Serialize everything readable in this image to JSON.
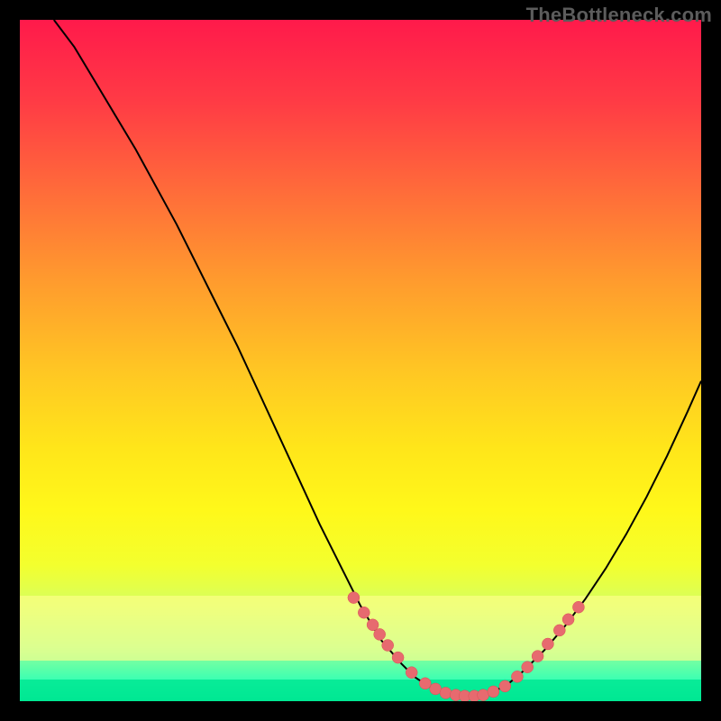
{
  "watermark": "TheBottleneck.com",
  "colors": {
    "gradient_top": "#ff1a4b",
    "gradient_bottom": "#00e893",
    "curve": "#000000",
    "marker": "#e76a6f",
    "frame_bg": "#000000"
  },
  "chart_data": {
    "type": "line",
    "title": "",
    "xlabel": "",
    "ylabel": "",
    "xlim": [
      0,
      100
    ],
    "ylim": [
      0,
      100
    ],
    "curve": {
      "x": [
        5,
        8,
        11,
        14,
        17,
        20,
        23,
        26,
        29,
        32,
        35,
        38,
        41,
        44,
        47,
        50,
        53,
        56,
        58,
        60,
        62,
        64,
        66,
        68,
        70,
        72,
        74,
        77,
        80,
        83,
        86,
        89,
        92,
        95,
        98,
        100
      ],
      "y": [
        100,
        96,
        91,
        86,
        81,
        75.5,
        70,
        64,
        58,
        52,
        45.5,
        39,
        32.5,
        26,
        20,
        14,
        9,
        5.5,
        3.5,
        2.2,
        1.4,
        0.9,
        0.7,
        0.9,
        1.6,
        2.8,
        4.5,
        7.5,
        11,
        15,
        19.5,
        24.5,
        30,
        36,
        42.5,
        47
      ]
    },
    "markers": [
      {
        "x": 49.0,
        "y": 15.2
      },
      {
        "x": 50.5,
        "y": 13.0
      },
      {
        "x": 51.8,
        "y": 11.2
      },
      {
        "x": 52.8,
        "y": 9.8
      },
      {
        "x": 54.0,
        "y": 8.2
      },
      {
        "x": 55.5,
        "y": 6.4
      },
      {
        "x": 57.5,
        "y": 4.2
      },
      {
        "x": 59.5,
        "y": 2.6
      },
      {
        "x": 61.0,
        "y": 1.8
      },
      {
        "x": 62.5,
        "y": 1.2
      },
      {
        "x": 64.0,
        "y": 0.9
      },
      {
        "x": 65.3,
        "y": 0.75
      },
      {
        "x": 66.7,
        "y": 0.75
      },
      {
        "x": 68.0,
        "y": 0.9
      },
      {
        "x": 69.5,
        "y": 1.4
      },
      {
        "x": 71.2,
        "y": 2.2
      },
      {
        "x": 73.0,
        "y": 3.6
      },
      {
        "x": 74.5,
        "y": 5.0
      },
      {
        "x": 76.0,
        "y": 6.6
      },
      {
        "x": 77.5,
        "y": 8.4
      },
      {
        "x": 79.2,
        "y": 10.4
      },
      {
        "x": 80.5,
        "y": 12.0
      },
      {
        "x": 82.0,
        "y": 13.8
      }
    ],
    "highlight_bands": [
      {
        "y_from": 15.5,
        "y_to": 6.0,
        "kind": "yellow"
      },
      {
        "y_from": 3.2,
        "y_to": 0.0,
        "kind": "green"
      }
    ]
  }
}
